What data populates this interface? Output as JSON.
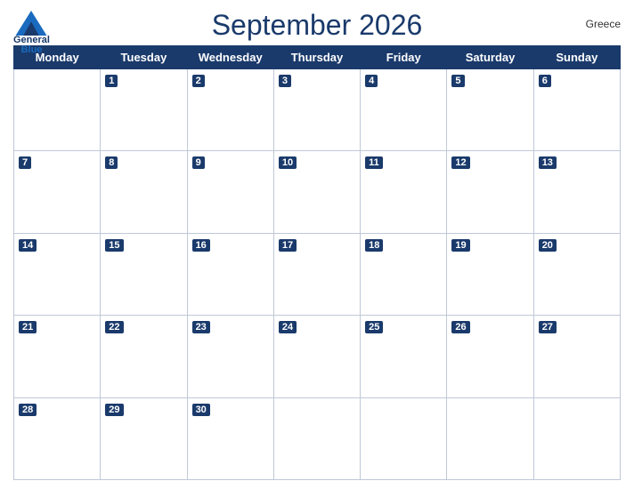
{
  "header": {
    "title": "September 2026",
    "country": "Greece",
    "logo": {
      "line1": "General",
      "line2": "Blue"
    }
  },
  "days_of_week": [
    "Monday",
    "Tuesday",
    "Wednesday",
    "Thursday",
    "Friday",
    "Saturday",
    "Sunday"
  ],
  "weeks": [
    [
      null,
      1,
      2,
      3,
      4,
      5,
      6
    ],
    [
      7,
      8,
      9,
      10,
      11,
      12,
      13
    ],
    [
      14,
      15,
      16,
      17,
      18,
      19,
      20
    ],
    [
      21,
      22,
      23,
      24,
      25,
      26,
      27
    ],
    [
      28,
      29,
      30,
      null,
      null,
      null,
      null
    ]
  ]
}
